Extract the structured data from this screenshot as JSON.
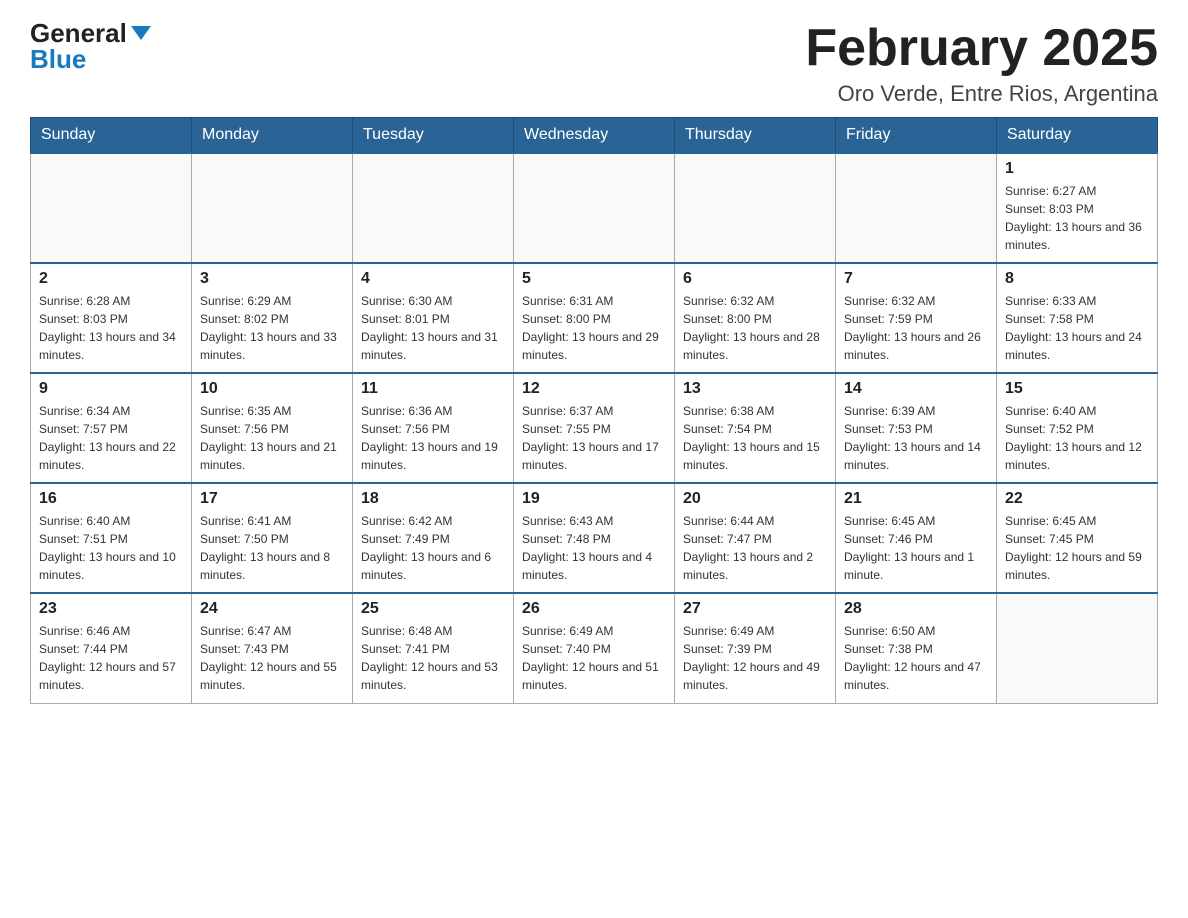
{
  "header": {
    "logo_general": "General",
    "logo_blue": "Blue",
    "month_title": "February 2025",
    "subtitle": "Oro Verde, Entre Rios, Argentina"
  },
  "weekdays": [
    "Sunday",
    "Monday",
    "Tuesday",
    "Wednesday",
    "Thursday",
    "Friday",
    "Saturday"
  ],
  "weeks": [
    [
      {
        "day": "",
        "info": ""
      },
      {
        "day": "",
        "info": ""
      },
      {
        "day": "",
        "info": ""
      },
      {
        "day": "",
        "info": ""
      },
      {
        "day": "",
        "info": ""
      },
      {
        "day": "",
        "info": ""
      },
      {
        "day": "1",
        "info": "Sunrise: 6:27 AM\nSunset: 8:03 PM\nDaylight: 13 hours and 36 minutes."
      }
    ],
    [
      {
        "day": "2",
        "info": "Sunrise: 6:28 AM\nSunset: 8:03 PM\nDaylight: 13 hours and 34 minutes."
      },
      {
        "day": "3",
        "info": "Sunrise: 6:29 AM\nSunset: 8:02 PM\nDaylight: 13 hours and 33 minutes."
      },
      {
        "day": "4",
        "info": "Sunrise: 6:30 AM\nSunset: 8:01 PM\nDaylight: 13 hours and 31 minutes."
      },
      {
        "day": "5",
        "info": "Sunrise: 6:31 AM\nSunset: 8:00 PM\nDaylight: 13 hours and 29 minutes."
      },
      {
        "day": "6",
        "info": "Sunrise: 6:32 AM\nSunset: 8:00 PM\nDaylight: 13 hours and 28 minutes."
      },
      {
        "day": "7",
        "info": "Sunrise: 6:32 AM\nSunset: 7:59 PM\nDaylight: 13 hours and 26 minutes."
      },
      {
        "day": "8",
        "info": "Sunrise: 6:33 AM\nSunset: 7:58 PM\nDaylight: 13 hours and 24 minutes."
      }
    ],
    [
      {
        "day": "9",
        "info": "Sunrise: 6:34 AM\nSunset: 7:57 PM\nDaylight: 13 hours and 22 minutes."
      },
      {
        "day": "10",
        "info": "Sunrise: 6:35 AM\nSunset: 7:56 PM\nDaylight: 13 hours and 21 minutes."
      },
      {
        "day": "11",
        "info": "Sunrise: 6:36 AM\nSunset: 7:56 PM\nDaylight: 13 hours and 19 minutes."
      },
      {
        "day": "12",
        "info": "Sunrise: 6:37 AM\nSunset: 7:55 PM\nDaylight: 13 hours and 17 minutes."
      },
      {
        "day": "13",
        "info": "Sunrise: 6:38 AM\nSunset: 7:54 PM\nDaylight: 13 hours and 15 minutes."
      },
      {
        "day": "14",
        "info": "Sunrise: 6:39 AM\nSunset: 7:53 PM\nDaylight: 13 hours and 14 minutes."
      },
      {
        "day": "15",
        "info": "Sunrise: 6:40 AM\nSunset: 7:52 PM\nDaylight: 13 hours and 12 minutes."
      }
    ],
    [
      {
        "day": "16",
        "info": "Sunrise: 6:40 AM\nSunset: 7:51 PM\nDaylight: 13 hours and 10 minutes."
      },
      {
        "day": "17",
        "info": "Sunrise: 6:41 AM\nSunset: 7:50 PM\nDaylight: 13 hours and 8 minutes."
      },
      {
        "day": "18",
        "info": "Sunrise: 6:42 AM\nSunset: 7:49 PM\nDaylight: 13 hours and 6 minutes."
      },
      {
        "day": "19",
        "info": "Sunrise: 6:43 AM\nSunset: 7:48 PM\nDaylight: 13 hours and 4 minutes."
      },
      {
        "day": "20",
        "info": "Sunrise: 6:44 AM\nSunset: 7:47 PM\nDaylight: 13 hours and 2 minutes."
      },
      {
        "day": "21",
        "info": "Sunrise: 6:45 AM\nSunset: 7:46 PM\nDaylight: 13 hours and 1 minute."
      },
      {
        "day": "22",
        "info": "Sunrise: 6:45 AM\nSunset: 7:45 PM\nDaylight: 12 hours and 59 minutes."
      }
    ],
    [
      {
        "day": "23",
        "info": "Sunrise: 6:46 AM\nSunset: 7:44 PM\nDaylight: 12 hours and 57 minutes."
      },
      {
        "day": "24",
        "info": "Sunrise: 6:47 AM\nSunset: 7:43 PM\nDaylight: 12 hours and 55 minutes."
      },
      {
        "day": "25",
        "info": "Sunrise: 6:48 AM\nSunset: 7:41 PM\nDaylight: 12 hours and 53 minutes."
      },
      {
        "day": "26",
        "info": "Sunrise: 6:49 AM\nSunset: 7:40 PM\nDaylight: 12 hours and 51 minutes."
      },
      {
        "day": "27",
        "info": "Sunrise: 6:49 AM\nSunset: 7:39 PM\nDaylight: 12 hours and 49 minutes."
      },
      {
        "day": "28",
        "info": "Sunrise: 6:50 AM\nSunset: 7:38 PM\nDaylight: 12 hours and 47 minutes."
      },
      {
        "day": "",
        "info": ""
      }
    ]
  ]
}
